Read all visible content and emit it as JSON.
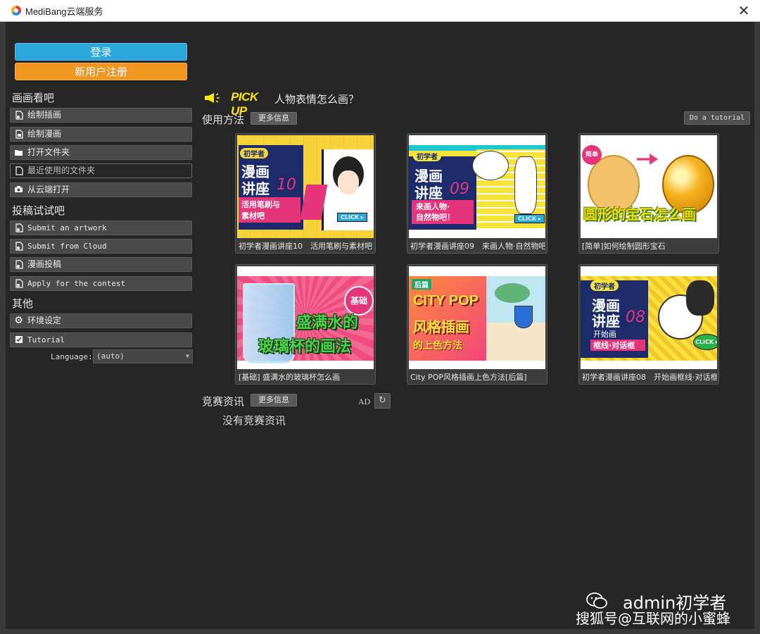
{
  "window": {
    "title": "MediBang云端服务"
  },
  "auth": {
    "login": "登录",
    "register": "新用户注册"
  },
  "sections": {
    "draw": "画画看吧",
    "submit": "投稿试试吧",
    "other": "其他"
  },
  "draw_items": [
    {
      "label": "绘制插画",
      "icon": "file-icon"
    },
    {
      "label": "绘制漫画",
      "icon": "file-icon"
    },
    {
      "label": "打开文件夹",
      "icon": "folder-icon"
    },
    {
      "label": "最近使用的文件夹",
      "icon": "recent-file-icon"
    },
    {
      "label": "从云端打开",
      "icon": "camera-icon"
    }
  ],
  "submit_items": [
    {
      "label": "Submit an artwork",
      "icon": "file-icon"
    },
    {
      "label": "Submit from Cloud",
      "icon": "file-icon"
    },
    {
      "label": "漫画投稿",
      "icon": "file-icon"
    },
    {
      "label": "Apply for the contest",
      "icon": "file-icon"
    }
  ],
  "other_items": [
    {
      "label": "环境设定",
      "icon": "gear-icon"
    },
    {
      "label": "Tutorial",
      "icon": "checkbox-icon"
    }
  ],
  "language": {
    "label": "Language:",
    "value": "(auto)"
  },
  "pickup": {
    "tag": "PICK UP",
    "text": "人物表情怎么画？"
  },
  "usage": {
    "label": "使用方法",
    "more": "更多信息",
    "tutorial": "Do a tutorial"
  },
  "tutorials": [
    {
      "caption": "初学者漫画讲座10　活用笔刷与素材吧",
      "thumb": {
        "badge": "初学者",
        "l1": "漫画",
        "l2": "讲座",
        "num": "10",
        "sub1": "活用笔刷与",
        "sub2": "素材吧",
        "click": "CLICK ▸"
      }
    },
    {
      "caption": "初学者漫画讲座09　来画人物·自然物吧！",
      "thumb": {
        "badge": "初学者",
        "l1": "漫画",
        "l2": "讲座",
        "num": "09",
        "sub1": "来画人物·",
        "sub2": "自然物吧！",
        "click": "CLICK ▸"
      }
    },
    {
      "caption": "[简单]如何绘制圆形宝石",
      "thumb": {
        "badge": "简单",
        "title": "圆形的宝石怎么画"
      }
    },
    {
      "caption": "[基础] 盛满水的玻璃杯怎么画",
      "thumb": {
        "badge": "基础",
        "l1": "盛满水的",
        "l2": "玻璃杯的画法"
      }
    },
    {
      "caption": "City POP风格插画上色方法[后篇]",
      "thumb": {
        "badge": "后篇",
        "l1": "CITY POP",
        "l2": "风格插画",
        "l3": "的上色方法"
      }
    },
    {
      "caption": "初学者漫画讲座08　开始画框线·对话框",
      "thumb": {
        "badge": "初学者",
        "l1": "漫画",
        "l2": "讲座",
        "num": "08",
        "sub0": "开始画",
        "sub1": "框线·对话框",
        "click": "CLICK ▸"
      }
    }
  ],
  "contest": {
    "label": "竞赛资讯",
    "more": "更多信息",
    "empty": "没有竞赛资讯",
    "ad": "AD"
  },
  "watermark": {
    "line1": "admin初学者",
    "line2": "搜狐号@互联网的小蜜蜂"
  },
  "colors": {
    "login": "#2aa7dc",
    "register": "#f0961e",
    "pickup": "#ffe600",
    "background": "#262626"
  }
}
